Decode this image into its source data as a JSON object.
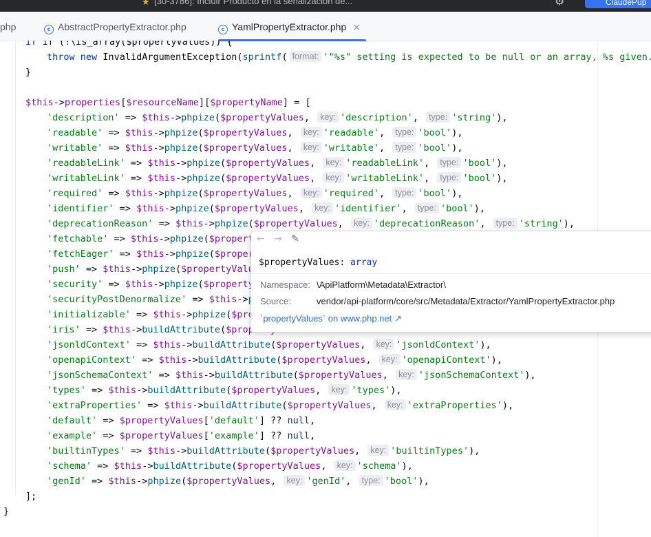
{
  "window": {
    "title_fragment": "[30-3786]: Incluir Producto en la señalización de...",
    "profile_button": "ClaudePup"
  },
  "tabs": [
    {
      "label": "php",
      "active": false
    },
    {
      "label": "AbstractPropertyExtractor.php",
      "active": false
    },
    {
      "label": "YamlPropertyExtractor.php",
      "active": true
    }
  ],
  "code": {
    "line_if": "if (!\\is_array($propertyValues)) {",
    "throw_kw": "throw",
    "new_kw": "new",
    "exception_class": "InvalidArgumentException",
    "sprintf_fn": "sprintf",
    "format_hint": "format:",
    "message": "'\"%s\" setting is expected to be null or an array, %s given.'",
    "close_brace": "}",
    "assign_prefix": "$this",
    "properties": "properties",
    "resource_name": "$resourceName",
    "property_name": "$propertyName",
    "close_array": "];",
    "final_brace": "}",
    "rows": [
      {
        "key": "'description'",
        "fn": "phpize",
        "hint1": "key:",
        "arg": "'description'",
        "hint2": "type:",
        "type": "'string'"
      },
      {
        "key": "'readable'",
        "fn": "phpize",
        "hint1": "key:",
        "arg": "'readable'",
        "hint2": "type:",
        "type": "'bool'"
      },
      {
        "key": "'writable'",
        "fn": "phpize",
        "hint1": "key:",
        "arg": "'writable'",
        "hint2": "type:",
        "type": "'bool'"
      },
      {
        "key": "'readableLink'",
        "fn": "phpize",
        "hint1": "key:",
        "arg": "'readableLink'",
        "hint2": "type:",
        "type": "'bool'"
      },
      {
        "key": "'writableLink'",
        "fn": "phpize",
        "hint1": "key:",
        "arg": "'writableLink'",
        "hint2": "type:",
        "type": "'bool'"
      },
      {
        "key": "'required'",
        "fn": "phpize",
        "hint1": "key:",
        "arg": "'required'",
        "hint2": "type:",
        "type": "'bool'"
      },
      {
        "key": "'identifier'",
        "fn": "phpize",
        "hint1": "key:",
        "arg": "'identifier'",
        "hint2": "type:",
        "type": "'bool'"
      },
      {
        "key": "'deprecationReason'",
        "fn": "phpize",
        "hint1": "key:",
        "arg": "'deprecationReason'",
        "hint2": "type:",
        "type": "'string'"
      },
      {
        "key": "'fetchable'",
        "fn": "phpize",
        "hint1": "",
        "arg": "",
        "hint2": "",
        "type": ""
      },
      {
        "key": "'fetchEager'",
        "fn": "phpize",
        "hint1": "",
        "arg": "",
        "hint2": "",
        "type": ""
      },
      {
        "key": "'push'",
        "fn": "phpize",
        "hint1": "",
        "arg": "",
        "hint2": "",
        "type": ""
      },
      {
        "key": "'security'",
        "fn": "phpize",
        "hint1": "",
        "arg": "",
        "hint2": "",
        "type": ""
      },
      {
        "key": "'securityPostDenormalize'",
        "fn": "phpize",
        "hint1": "",
        "arg": "",
        "hint2": "",
        "type": ""
      },
      {
        "key": "'initializable'",
        "fn": "phpize",
        "hint1": "",
        "arg": "",
        "hint2": "",
        "type": ""
      },
      {
        "key": "'iris'",
        "fn": "buildAttribute",
        "hint1": "",
        "arg": "",
        "hint2": "",
        "type": ""
      },
      {
        "key": "'jsonldContext'",
        "fn": "buildAttribute",
        "hint1": "key:",
        "arg": "'jsonldContext'",
        "hint2": "",
        "type": ""
      },
      {
        "key": "'openapiContext'",
        "fn": "buildAttribute",
        "hint1": "key:",
        "arg": "'openapiContext'",
        "hint2": "",
        "type": ""
      },
      {
        "key": "'jsonSchemaContext'",
        "fn": "buildAttribute",
        "hint1": "key:",
        "arg": "'jsonSchemaContext'",
        "hint2": "",
        "type": ""
      },
      {
        "key": "'types'",
        "fn": "buildAttribute",
        "hint1": "key:",
        "arg": "'types'",
        "hint2": "",
        "type": ""
      },
      {
        "key": "'extraProperties'",
        "fn": "buildAttribute",
        "hint1": "key:",
        "arg": "'extraProperties'",
        "hint2": "",
        "type": ""
      },
      {
        "key": "'default'",
        "fn": "",
        "arr": "'default'"
      },
      {
        "key": "'example'",
        "fn": "",
        "arr": "'example'"
      },
      {
        "key": "'builtinTypes'",
        "fn": "buildAttribute",
        "hint1": "key:",
        "arg": "'builtinTypes'",
        "hint2": "",
        "type": ""
      },
      {
        "key": "'schema'",
        "fn": "buildAttribute",
        "hint1": "key:",
        "arg": "'schema'",
        "hint2": "",
        "type": ""
      },
      {
        "key": "'genId'",
        "fn": "phpize",
        "hint1": "key:",
        "arg": "'genId'",
        "hint2": "type:",
        "type": "'bool'"
      }
    ]
  },
  "popup": {
    "back": "←",
    "forward": "→",
    "edit": "✎",
    "signature_var": "$propertyValues:",
    "signature_type": "array",
    "namespace_label": "Namespace:",
    "namespace_value": "\\ApiPlatform\\Metadata\\Extractor\\",
    "source_label": "Source:",
    "source_value": "vendor/api-platform/core/src/Metadata/Extractor/YamlPropertyExtractor.php",
    "link_text": "`propertyValues` on www.php.net ↗"
  }
}
